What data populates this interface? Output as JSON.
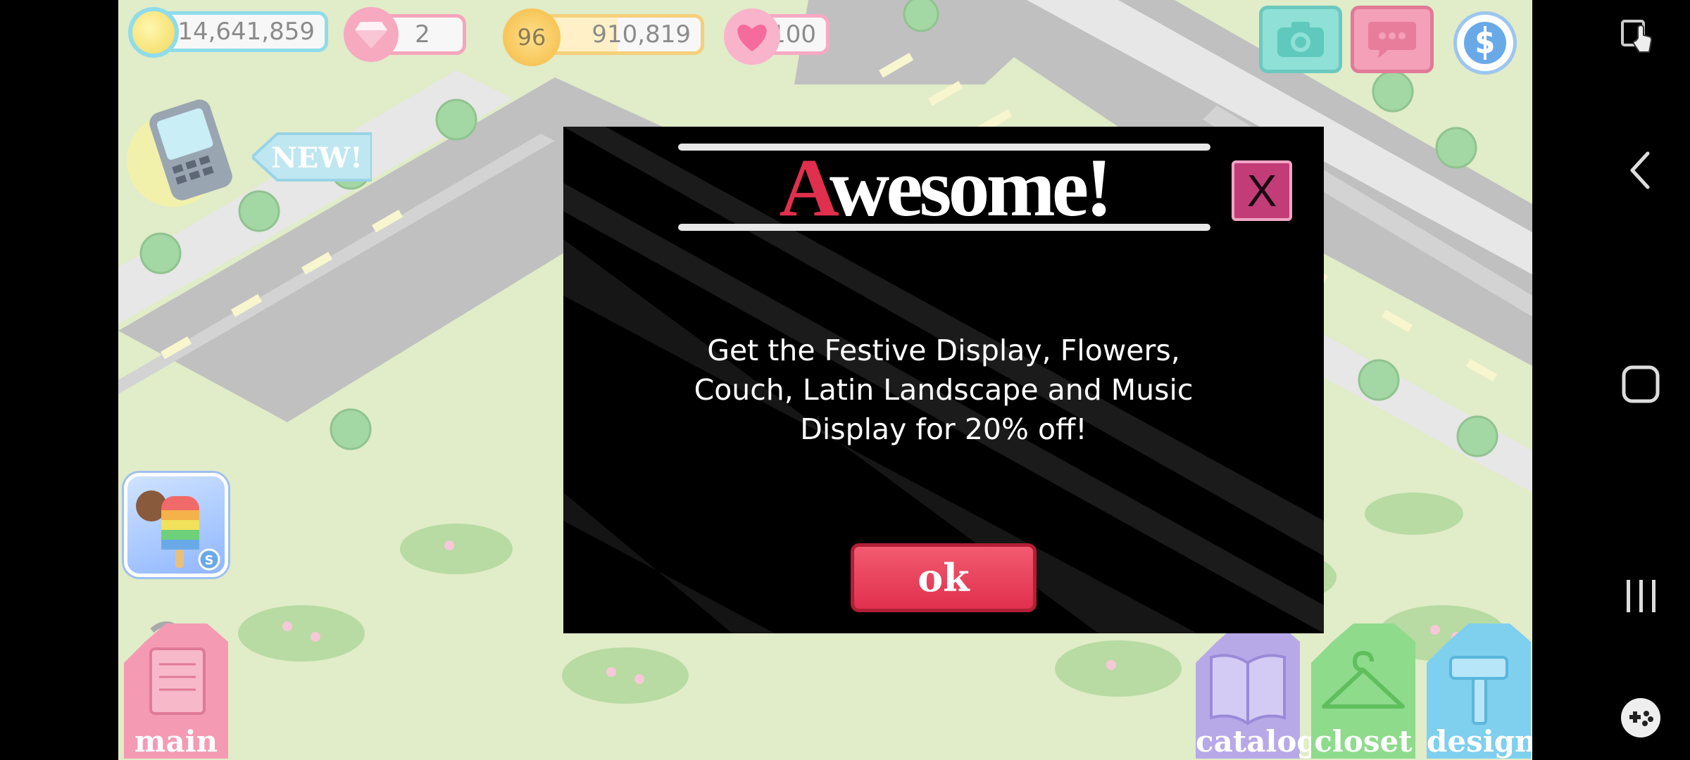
{
  "hud": {
    "coins": "14,641,859",
    "gems": "2",
    "level": "96",
    "xp": "910,819",
    "hearts": "100"
  },
  "top_right": {
    "camera_icon": "camera-icon",
    "chat_icon": "chat-bubble-icon",
    "currency_icon": "dollar-coin-icon"
  },
  "left_widgets": {
    "new_badge": "NEW!",
    "phone_icon": "phone-icon",
    "popsicle_icon": "popsicle-icon"
  },
  "modal": {
    "title_first_letter": "A",
    "title_rest": "wesome!",
    "close_label": "X",
    "message": "Get the Festive Display, Flowers, Couch, Latin Landscape and Music Display for 20% off!",
    "ok_label": "ok"
  },
  "tabs": {
    "main": "main",
    "catalog": "catalog",
    "closet": "closet",
    "design": "design"
  },
  "colors": {
    "accent_red": "#e0304d",
    "close_pink": "#c23d77",
    "coin_teal": "#7fd6e8",
    "gem_pink": "#f08aa6",
    "xp_gold": "#f5c04a",
    "heart_pink": "#f58bb0"
  },
  "android_nav": {
    "screenshot_icon": "screenshot-edit-icon",
    "back_icon": "back-icon",
    "home_icon": "home-icon",
    "recents_icon": "recents-icon",
    "game_icon": "gamepad-icon"
  }
}
